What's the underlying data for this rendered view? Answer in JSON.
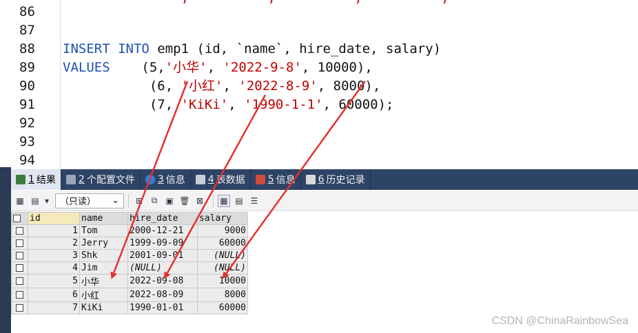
{
  "editor": {
    "lines": [
      {
        "no": "86"
      },
      {
        "no": "87"
      },
      {
        "no": "88",
        "kw1": "INSERT",
        "kw2": "INTO",
        "rest": " emp1 (id, `name`, hire_date, salary)"
      },
      {
        "no": "89",
        "kw1": "VALUES",
        "p1": "    (5,",
        "s1": "'小华'",
        "p2": ", ",
        "s2": "'2022-9-8'",
        "p3": ", 10000),"
      },
      {
        "no": "90",
        "p1": "           (6, ",
        "s1": "'小红'",
        "p2": ", ",
        "s2": "'2022-8-9'",
        "p3": ", 8000),"
      },
      {
        "no": "91",
        "p1": "           (7, ",
        "s1": "'KiKi'",
        "p2": ", ",
        "s2": "'1990-1-1'",
        "p3": ", 60000);"
      },
      {
        "no": "92"
      },
      {
        "no": "93"
      },
      {
        "no": "94"
      }
    ]
  },
  "tabs": [
    {
      "num": "1",
      "label": "结果",
      "icon": "result-grid-icon",
      "color": "#3a7d3a"
    },
    {
      "num": "2",
      "label": "个配置文件",
      "icon": "profile-icon",
      "color": "#9aa6b8"
    },
    {
      "num": "3",
      "label": "信息",
      "icon": "info-icon",
      "color": "#2f7fd6"
    },
    {
      "num": "4",
      "label": "表数据",
      "icon": "table-data-icon",
      "color": "#c8ced8"
    },
    {
      "num": "5",
      "label": "信息",
      "icon": "info-blocks-icon",
      "color": "#d24a3a"
    },
    {
      "num": "6",
      "label": "历史记录",
      "icon": "history-icon",
      "color": "#d9d9d9"
    }
  ],
  "toolbar": {
    "mode": "（只读）"
  },
  "grid": {
    "columns": [
      "id",
      "name",
      "hire_date",
      "salary"
    ],
    "rows": [
      {
        "id": "1",
        "name": "Tom",
        "hire_date": "2000-12-21",
        "salary": "9000"
      },
      {
        "id": "2",
        "name": "Jerry",
        "hire_date": "1999-09-09",
        "salary": "60000"
      },
      {
        "id": "3",
        "name": "Shk",
        "hire_date": "2001-09-01",
        "salary": "(NULL)"
      },
      {
        "id": "4",
        "name": "Jim",
        "hire_date": "(NULL)",
        "salary": "(NULL)"
      },
      {
        "id": "5",
        "name": "小华",
        "hire_date": "2022-09-08",
        "salary": "10000"
      },
      {
        "id": "6",
        "name": "小红",
        "hire_date": "2022-08-09",
        "salary": "8000"
      },
      {
        "id": "7",
        "name": "KiKi",
        "hire_date": "1990-01-01",
        "salary": "60000"
      }
    ]
  },
  "watermark": "CSDN @ChinaRainbowSea",
  "colors": {
    "arrow": "#e53030",
    "keyword": "#1f4fb0",
    "string": "#c00000"
  }
}
